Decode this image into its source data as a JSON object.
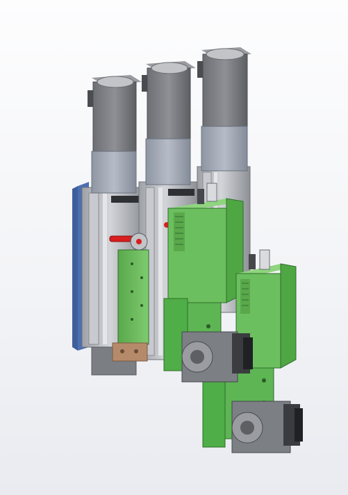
{
  "viewport": {
    "background_top": "#fdfdfe",
    "background_bottom": "#e9ebf0"
  },
  "model": {
    "components": [
      {
        "name": "linear-actuator-1",
        "kind": "linear-actuator"
      },
      {
        "name": "linear-actuator-2",
        "kind": "linear-actuator"
      },
      {
        "name": "linear-actuator-3",
        "kind": "linear-actuator"
      },
      {
        "name": "stepper-motor-1",
        "kind": "stepper-motor"
      },
      {
        "name": "stepper-motor-2",
        "kind": "stepper-motor"
      },
      {
        "name": "stepper-motor-3",
        "kind": "stepper-motor"
      },
      {
        "name": "controller-box-1",
        "kind": "electronics-enclosure"
      },
      {
        "name": "controller-box-2",
        "kind": "electronics-enclosure"
      },
      {
        "name": "mounting-plate",
        "kind": "plate"
      },
      {
        "name": "cooling-fan-1",
        "kind": "fan"
      },
      {
        "name": "cooling-fan-2",
        "kind": "fan"
      },
      {
        "name": "release-lever",
        "kind": "lever"
      }
    ],
    "colors": {
      "motor_dark": "#7d7f84",
      "motor_coupler": "#a4aab5",
      "rail": "#b8bbc0",
      "enclosure_green": "#6cbf5e",
      "plate_green": "#4fae47",
      "base_blue": "#5a7fc0",
      "lever_red": "#d81e1e",
      "bracket_brown": "#b58a6a"
    }
  }
}
